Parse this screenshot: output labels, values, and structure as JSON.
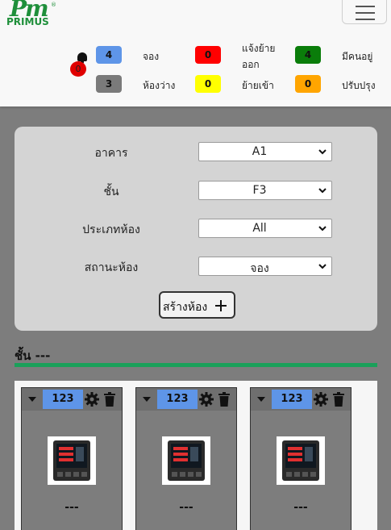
{
  "header": {
    "logo_mark": "Pm",
    "logo_text": "PRIMUS",
    "logo_reg": "®",
    "notification_count": "0"
  },
  "stats": [
    {
      "count": "4",
      "label": "จอง",
      "color": "#5e95e8",
      "text_color": "#111111"
    },
    {
      "count": "0",
      "label": "แจ้งย้ายออก",
      "color": "#ff0000",
      "text_color": "#111111"
    },
    {
      "count": "4",
      "label": "มีคนอยู่",
      "color": "#0a7d0a",
      "text_color": "#111111"
    },
    {
      "count": "3",
      "label": "ห้องว่าง",
      "color": "#7a7a7a",
      "text_color": "#111111"
    },
    {
      "count": "0",
      "label": "ย้ายเข้า",
      "color": "#ffff00",
      "text_color": "#111111"
    },
    {
      "count": "0",
      "label": "ปรับปรุง",
      "color": "#ffa500",
      "text_color": "#111111"
    }
  ],
  "filters": [
    {
      "label": "อาคาร",
      "value": "A1"
    },
    {
      "label": "ชั้น",
      "value": "F3"
    },
    {
      "label": "ประเภทห้อง",
      "value": "All"
    },
    {
      "label": "สถานะห้อง",
      "value": "จอง"
    }
  ],
  "create_button": {
    "label": "สร้างห้อง"
  },
  "floor": {
    "title": "ชั้น ---"
  },
  "rooms": [
    {
      "number": "123",
      "name": "---",
      "status_color": "#5e95e8"
    },
    {
      "number": "123",
      "name": "---",
      "status_color": "#5e95e8"
    },
    {
      "number": "123",
      "name": "---",
      "status_color": "#5e95e8"
    }
  ],
  "icons": {
    "notification": "bell-icon",
    "menu": "hamburger-menu-icon",
    "select": "chevron-down-icon",
    "create": "plus-icon",
    "room_toggle": "caret-down-icon",
    "room_settings": "gear-icon",
    "room_delete": "trash-icon",
    "room_image": "power-meter-image"
  }
}
